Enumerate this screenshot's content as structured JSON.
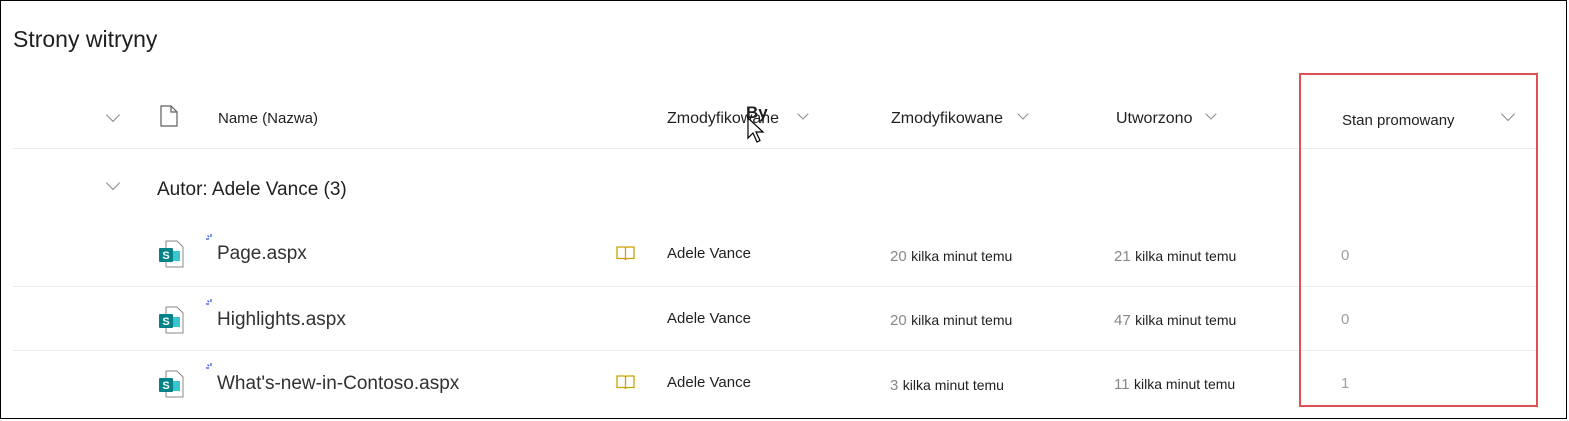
{
  "page": {
    "title": "Strony witryny"
  },
  "columns": {
    "name": "Name (Nazwa)",
    "modified_by": "Zmodyfikowane",
    "modified_by_overlay": "By",
    "modified": "Zmodyfikowane",
    "created": "Utworzono",
    "promoted_state": "Stan promowany"
  },
  "group": {
    "label": "Autor: Adele Vance (3)"
  },
  "rows": [
    {
      "name": "Page.aspx",
      "has_book_icon": true,
      "modified_by": "Adele Vance",
      "modified_num": "20",
      "modified_text": "kilka minut temu",
      "created_num": "21",
      "created_text": "kilka minut temu",
      "promoted_state": "0"
    },
    {
      "name": "Highlights.aspx",
      "has_book_icon": false,
      "modified_by": "Adele Vance",
      "modified_num": "20",
      "modified_text": "kilka minut temu",
      "created_num": "47",
      "created_text": "kilka minut temu",
      "promoted_state": "0"
    },
    {
      "name": "What's-new-in-Contoso.aspx",
      "has_book_icon": true,
      "modified_by": "Adele Vance",
      "modified_num": "3",
      "modified_text": "kilka minut temu",
      "created_num": "11",
      "created_text": "kilka minut temu",
      "promoted_state": "1"
    }
  ],
  "icons": {
    "file_type_header": "document-icon",
    "row_file": "sharepoint-page-icon",
    "new_item": "new-sparkle-icon",
    "book": "book-icon",
    "cursor": "mouse-cursor-icon"
  },
  "colors": {
    "highlight_box": "#e05050",
    "sharepoint_teal": "#038387",
    "book_icon": "#c8a200"
  }
}
